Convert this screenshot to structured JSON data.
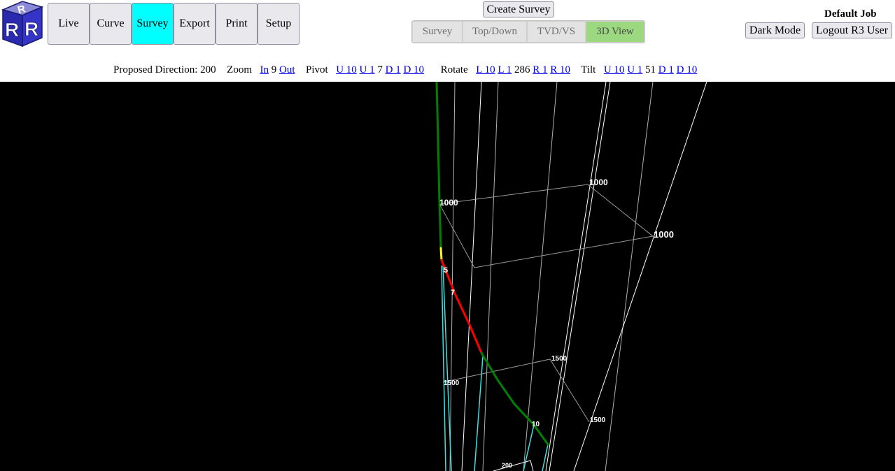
{
  "logo": {
    "letters": [
      "R",
      "R",
      "R"
    ]
  },
  "nav": {
    "items": [
      {
        "label": "Live"
      },
      {
        "label": "Curve"
      },
      {
        "label": "Survey",
        "active": true
      },
      {
        "label": "Export"
      },
      {
        "label": "Print"
      },
      {
        "label": "Setup"
      }
    ]
  },
  "survey": {
    "create_label": "Create Survey",
    "views": [
      {
        "label": "Survey"
      },
      {
        "label": "Top/Down"
      },
      {
        "label": "TVD/VS"
      },
      {
        "label": "3D View",
        "active": true
      }
    ]
  },
  "header": {
    "job_title": "Default Job",
    "dark_mode_label": "Dark Mode",
    "logout_label": "Logout R3 User"
  },
  "controls": {
    "direction_label": "Proposed Direction:",
    "direction_value": "200",
    "zoom_label": "Zoom",
    "zoom_in": "In",
    "zoom_value": "9",
    "zoom_out": "Out",
    "pivot_label": "Pivot",
    "pivot_u10": "U 10",
    "pivot_u1": "U 1",
    "pivot_value": "7",
    "pivot_d1": "D 1",
    "pivot_d10": "D 10",
    "rotate_label": "Rotate",
    "rotate_l10": "L 10",
    "rotate_l1": "L 1",
    "rotate_value": "286",
    "rotate_r1": "R 1",
    "rotate_r10": "R 10",
    "tilt_label": "Tilt",
    "tilt_u10": "U 10",
    "tilt_u1": "U 1",
    "tilt_value": "51",
    "tilt_d1": "D 1",
    "tilt_d10": "D 10"
  },
  "view3d": {
    "colors": {
      "background": "#000000",
      "grid": "#ffffff",
      "box": "#9a9a9a",
      "well_path": "#008000",
      "build_section": "#ff0000",
      "kickoff": "#ffff00",
      "projection": "#40e0e0",
      "label": "#ffffff"
    },
    "labels": {
      "grid_1000_left": "1000",
      "grid_1000_mid": "1000",
      "grid_1000_right": "1000",
      "station_5": "5",
      "station_7": "7",
      "grid_1500_left": "1500",
      "grid_1500_mid": "1500",
      "grid_1500_right": "1500",
      "station_10": "10",
      "grid_200": "200"
    }
  }
}
